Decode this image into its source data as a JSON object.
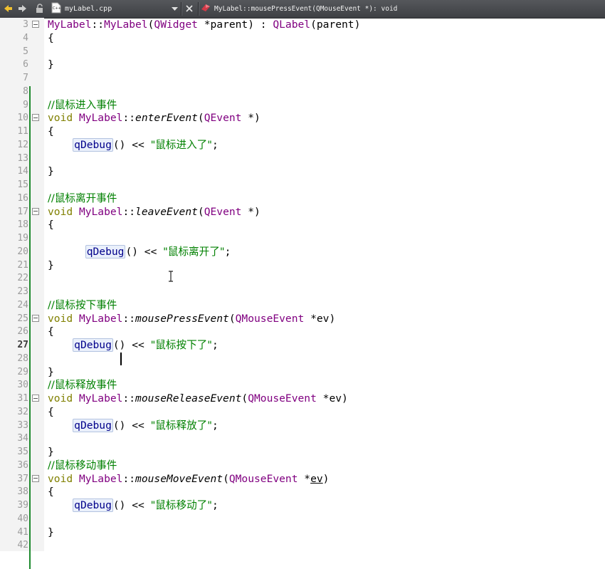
{
  "toolbar": {
    "file_name": "myLabel.cpp",
    "function_signature": "MyLabel::mousePressEvent(QMouseEvent *): void",
    "icons": [
      "back-icon",
      "forward-icon",
      "lock-icon",
      "cpp-file-icon",
      "dropdown-arrow-icon",
      "close-icon",
      "function-icon"
    ]
  },
  "colors": {
    "type": "#800080",
    "keyword": "#808000",
    "comment": "#008000",
    "string": "#008000",
    "change_bar": "#1e8a2e",
    "highlight": "#eaf0fb"
  },
  "current_line": "27",
  "lines": [
    {
      "no": "3",
      "fold": true,
      "c": {
        "t1": "MyLabel",
        "s1": "::",
        "t2": "MyLabel",
        "s2": "(",
        "t3": "QWidget",
        "s3": " *parent) : ",
        "t4": "QLabel",
        "s4": "(parent)"
      }
    },
    {
      "no": "4",
      "fold": false,
      "text": "{"
    },
    {
      "no": "5",
      "fold": false,
      "text": ""
    },
    {
      "no": "6",
      "fold": false,
      "text": "}"
    },
    {
      "no": "7",
      "fold": false,
      "text": ""
    },
    {
      "no": "8",
      "fold": false,
      "text": ""
    },
    {
      "no": "9",
      "fold": false,
      "comment": "//鼠标进入事件"
    },
    {
      "no": "10",
      "fold": true,
      "sig": {
        "kw": "void",
        "cls": "MyLabel",
        "sep": "::",
        "fn": "enterEvent",
        "open": "(",
        "ptype": "QEvent",
        "rest": " *)"
      }
    },
    {
      "no": "11",
      "fold": false,
      "text": "{"
    },
    {
      "no": "12",
      "fold": false,
      "dbg": {
        "call": "qDebug",
        "mid": "() << ",
        "str": "\"鼠标进入了\"",
        "end": ";"
      }
    },
    {
      "no": "13",
      "fold": false,
      "text": ""
    },
    {
      "no": "14",
      "fold": false,
      "text": "}"
    },
    {
      "no": "15",
      "fold": false,
      "text": ""
    },
    {
      "no": "16",
      "fold": false,
      "comment": "//鼠标离开事件"
    },
    {
      "no": "17",
      "fold": true,
      "sig": {
        "kw": "void",
        "cls": "MyLabel",
        "sep": "::",
        "fn": "leaveEvent",
        "open": "(",
        "ptype": "QEvent",
        "rest": " *)"
      }
    },
    {
      "no": "18",
      "fold": false,
      "text": "{"
    },
    {
      "no": "19",
      "fold": false,
      "text": ""
    },
    {
      "no": "20",
      "fold": false,
      "dbg": {
        "call": "qDebug",
        "mid": "() << ",
        "str": "\"鼠标离开了\"",
        "end": ";"
      }
    },
    {
      "no": "21",
      "fold": false,
      "text": "}"
    },
    {
      "no": "22",
      "fold": false,
      "text": ""
    },
    {
      "no": "23",
      "fold": false,
      "text": ""
    },
    {
      "no": "24",
      "fold": false,
      "comment": "//鼠标按下事件"
    },
    {
      "no": "25",
      "fold": true,
      "sig": {
        "kw": "void",
        "cls": "MyLabel",
        "sep": "::",
        "fn": "mousePressEvent",
        "open": "(",
        "ptype": "QMouseEvent",
        "rest": " *ev)"
      }
    },
    {
      "no": "26",
      "fold": false,
      "text": "{"
    },
    {
      "no": "27",
      "fold": false,
      "dbg": {
        "call": "qDebug",
        "mid": "() << ",
        "str": "\"鼠标按下了\"",
        "end": ";"
      }
    },
    {
      "no": "28",
      "fold": false,
      "text": ""
    },
    {
      "no": "29",
      "fold": false,
      "text": "}"
    },
    {
      "no": "30",
      "fold": false,
      "comment": "//鼠标释放事件"
    },
    {
      "no": "31",
      "fold": true,
      "sig": {
        "kw": "void",
        "cls": "MyLabel",
        "sep": "::",
        "fn": "mouseReleaseEvent",
        "open": "(",
        "ptype": "QMouseEvent",
        "rest": " *ev)"
      }
    },
    {
      "no": "32",
      "fold": false,
      "text": "{"
    },
    {
      "no": "33",
      "fold": false,
      "dbg": {
        "call": "qDebug",
        "mid": "() << ",
        "str": "\"鼠标释放了\"",
        "end": ";"
      }
    },
    {
      "no": "34",
      "fold": false,
      "text": ""
    },
    {
      "no": "35",
      "fold": false,
      "text": "}"
    },
    {
      "no": "36",
      "fold": false,
      "comment": "//鼠标移动事件"
    },
    {
      "no": "37",
      "fold": true,
      "sig": {
        "kw": "void",
        "cls": "MyLabel",
        "sep": "::",
        "fn": "mouseMoveEvent",
        "open": "(",
        "ptype": "QMouseEvent",
        "rest": " *",
        "arg": "ev",
        "close": ")"
      }
    },
    {
      "no": "38",
      "fold": false,
      "text": "{"
    },
    {
      "no": "39",
      "fold": false,
      "dbg": {
        "call": "qDebug",
        "mid": "() << ",
        "str": "\"鼠标移动了\"",
        "end": ";"
      }
    },
    {
      "no": "40",
      "fold": false,
      "text": ""
    },
    {
      "no": "41",
      "fold": false,
      "text": "}"
    },
    {
      "no": "42",
      "fold": false,
      "text": ""
    }
  ]
}
